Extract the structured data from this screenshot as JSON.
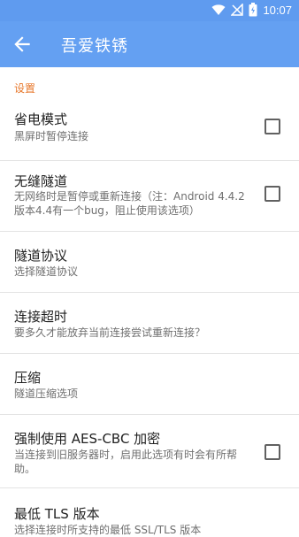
{
  "status": {
    "time": "10:07"
  },
  "appbar": {
    "title": "吾爱铁锈"
  },
  "section": "设置",
  "items": [
    {
      "title": "省电模式",
      "summary": "黑屏时暂停连接"
    },
    {
      "title": "无缝隧道",
      "summary": "无网络时是暂停或重新连接（注：Android 4.4.2版本4.4有一个bug，阻止使用该选项）"
    },
    {
      "title": "隧道协议",
      "summary": "选择隧道协议"
    },
    {
      "title": "连接超时",
      "summary": "要多久才能放弃当前连接尝试重新连接？"
    },
    {
      "title": "压缩",
      "summary": "隧道压缩选项"
    },
    {
      "title": "强制使用 AES-CBC 加密",
      "summary": "当连接到旧服务器时，启用此选项有时会有所帮助。"
    },
    {
      "title": "最低 TLS 版本",
      "summary": "选择连接时所支持的最低 SSL/TLS 版本"
    }
  ],
  "colors": {
    "appbar": "#64a0f2",
    "statusbar": "#5f9bef",
    "section": "#e7772a"
  },
  "icons": {
    "back": "arrow-back-icon",
    "wifi": "wifi-icon",
    "signal": "signal-icon",
    "battery": "battery-icon"
  }
}
